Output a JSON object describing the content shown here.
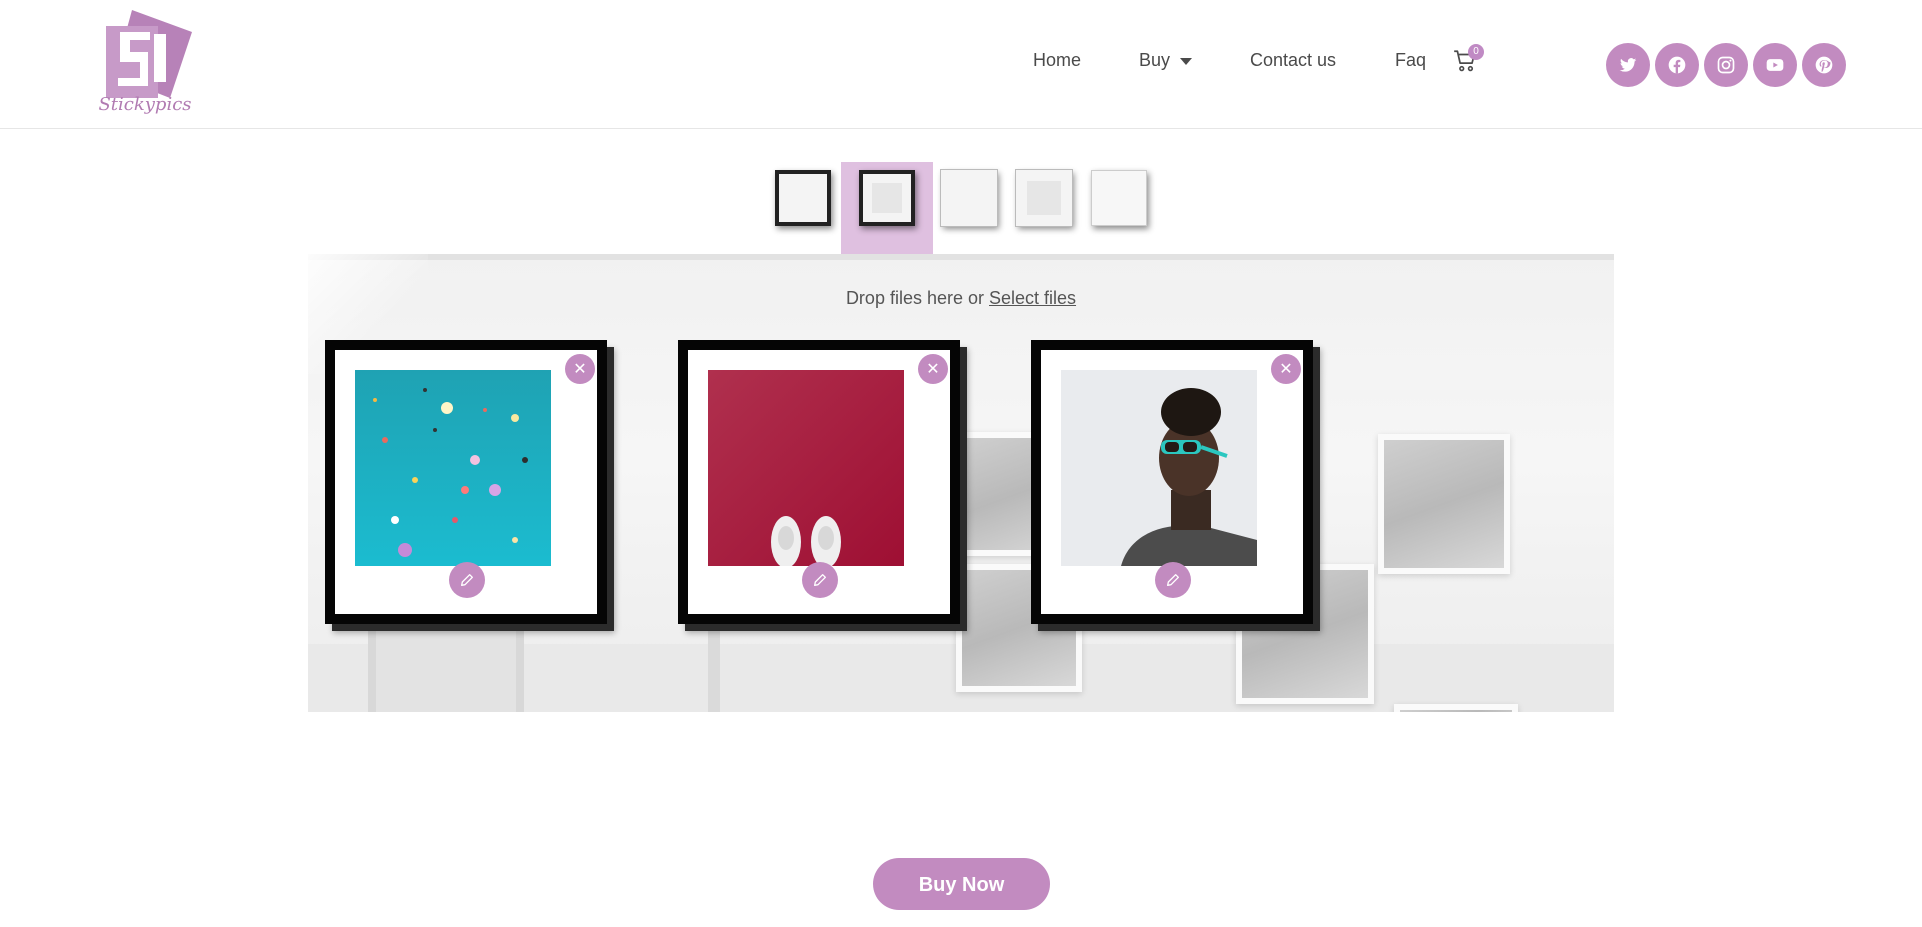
{
  "brand": {
    "logo_text": "Stickypics",
    "accent_color": "#c28bc0"
  },
  "nav": {
    "items": [
      {
        "label": "Home"
      },
      {
        "label": "Buy",
        "has_dropdown": true
      },
      {
        "label": "Contact us"
      },
      {
        "label": "Faq"
      }
    ],
    "cart": {
      "icon": "cart-icon",
      "count": "0"
    }
  },
  "socials": [
    {
      "icon": "twitter-icon"
    },
    {
      "icon": "facebook-icon"
    },
    {
      "icon": "instagram-icon"
    },
    {
      "icon": "youtube-icon"
    },
    {
      "icon": "pinterest-icon"
    }
  ],
  "frame_styles": {
    "options": [
      "black-frame",
      "black-frame-with-mat",
      "white-frame",
      "white-frame-with-mat",
      "frameless"
    ],
    "selected_index": 1
  },
  "upload": {
    "drop_text": "Drop files here or ",
    "select_link": "Select files"
  },
  "photos": [
    {
      "subject": "teal confetti",
      "remove_icon": "close-icon",
      "edit_icon": "pencil-icon"
    },
    {
      "subject": "sneakers on red floor",
      "remove_icon": "close-icon",
      "edit_icon": "pencil-icon"
    },
    {
      "subject": "woman with teal sunglasses",
      "remove_icon": "close-icon",
      "edit_icon": "pencil-icon"
    }
  ],
  "buy": {
    "label": "Buy Now"
  }
}
